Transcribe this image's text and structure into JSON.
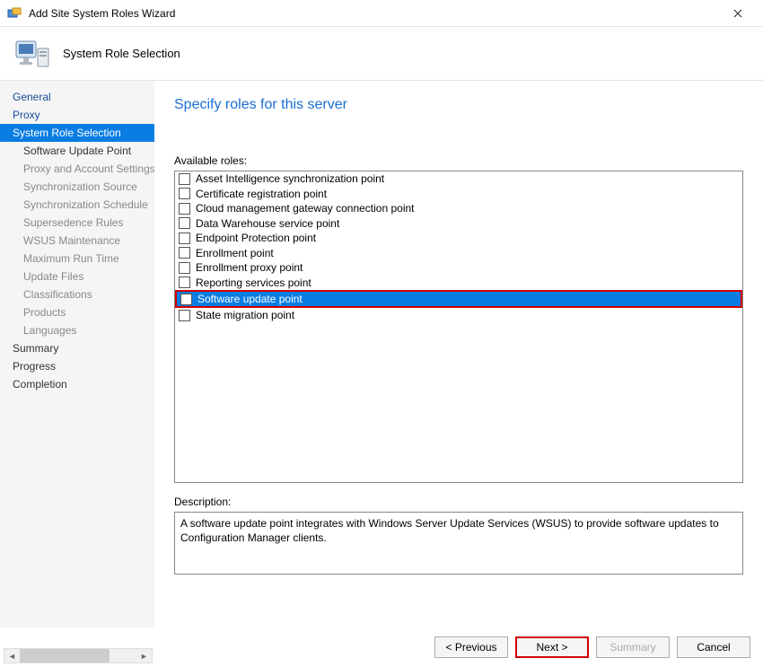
{
  "window": {
    "title": "Add Site System Roles Wizard"
  },
  "header": {
    "title": "System Role Selection"
  },
  "nav": {
    "items": [
      {
        "label": "General",
        "level": 0,
        "state": "top"
      },
      {
        "label": "Proxy",
        "level": 0,
        "state": "top"
      },
      {
        "label": "System Role Selection",
        "level": 0,
        "state": "selected"
      },
      {
        "label": "Software Update Point",
        "level": 1,
        "state": "active"
      },
      {
        "label": "Proxy and Account Settings",
        "level": 1,
        "state": ""
      },
      {
        "label": "Synchronization Source",
        "level": 1,
        "state": ""
      },
      {
        "label": "Synchronization Schedule",
        "level": 1,
        "state": ""
      },
      {
        "label": "Supersedence Rules",
        "level": 1,
        "state": ""
      },
      {
        "label": "WSUS Maintenance",
        "level": 1,
        "state": ""
      },
      {
        "label": "Maximum Run Time",
        "level": 1,
        "state": ""
      },
      {
        "label": "Update Files",
        "level": 1,
        "state": ""
      },
      {
        "label": "Classifications",
        "level": 1,
        "state": ""
      },
      {
        "label": "Products",
        "level": 1,
        "state": ""
      },
      {
        "label": "Languages",
        "level": 1,
        "state": ""
      },
      {
        "label": "Summary",
        "level": 0,
        "state": ""
      },
      {
        "label": "Progress",
        "level": 0,
        "state": ""
      },
      {
        "label": "Completion",
        "level": 0,
        "state": ""
      }
    ]
  },
  "main": {
    "page_title": "Specify roles for this server",
    "available_label": "Available roles:",
    "roles": [
      {
        "label": "Asset Intelligence synchronization point",
        "checked": false,
        "selected": false
      },
      {
        "label": "Certificate registration point",
        "checked": false,
        "selected": false
      },
      {
        "label": "Cloud management gateway connection point",
        "checked": false,
        "selected": false
      },
      {
        "label": "Data Warehouse service point",
        "checked": false,
        "selected": false
      },
      {
        "label": "Endpoint Protection point",
        "checked": false,
        "selected": false
      },
      {
        "label": "Enrollment point",
        "checked": false,
        "selected": false
      },
      {
        "label": "Enrollment proxy point",
        "checked": false,
        "selected": false
      },
      {
        "label": "Reporting services point",
        "checked": false,
        "selected": false
      },
      {
        "label": "Software update point",
        "checked": true,
        "selected": true
      },
      {
        "label": "State migration point",
        "checked": false,
        "selected": false
      }
    ],
    "description_label": "Description:",
    "description_text": "A software update point integrates with Windows Server Update Services (WSUS) to provide software updates to Configuration Manager clients."
  },
  "footer": {
    "previous": "< Previous",
    "next": "Next >",
    "summary": "Summary",
    "cancel": "Cancel"
  }
}
